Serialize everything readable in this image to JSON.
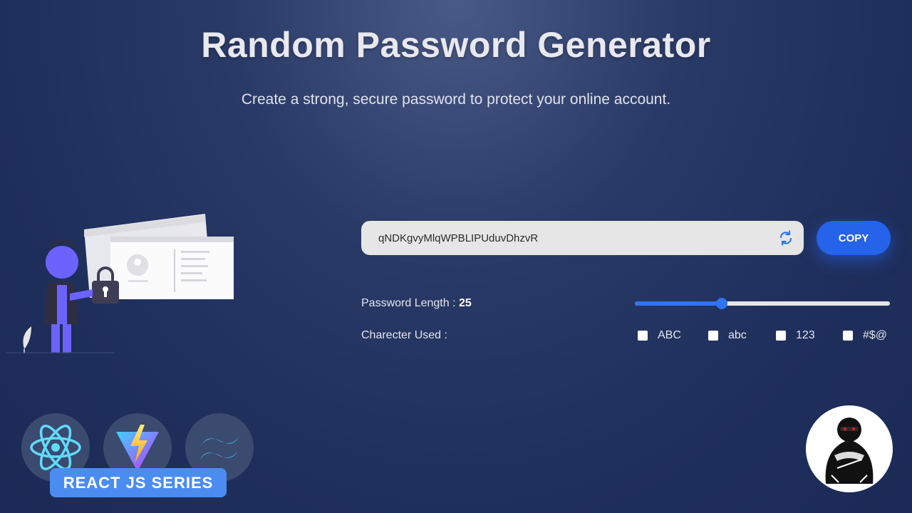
{
  "header": {
    "title": "Random Password Generator",
    "subtitle": "Create a strong, secure password to protect your online account."
  },
  "password": {
    "value": "qNDKgvyMlqWPBLIPUduvDhzvR"
  },
  "copy_label": "COPY",
  "length": {
    "label": "Password Length :",
    "value": "25",
    "slider_fraction": 0.34
  },
  "chars": {
    "label": "Charecter Used :",
    "options": [
      {
        "label": "ABC",
        "checked": false
      },
      {
        "label": "abc",
        "checked": false
      },
      {
        "label": "123",
        "checked": false
      },
      {
        "label": "#$@",
        "checked": false
      }
    ]
  },
  "series_label": "REACT JS SERIES",
  "icons": {
    "refresh": "refresh-icon",
    "react": "react-logo",
    "vite": "vite-logo",
    "tailwind": "tailwind-logo",
    "channel": "ninja-avatar"
  },
  "colors": {
    "accent": "#2563eb",
    "slider": "#2f74f0",
    "series_badge": "#4b8cf0"
  }
}
